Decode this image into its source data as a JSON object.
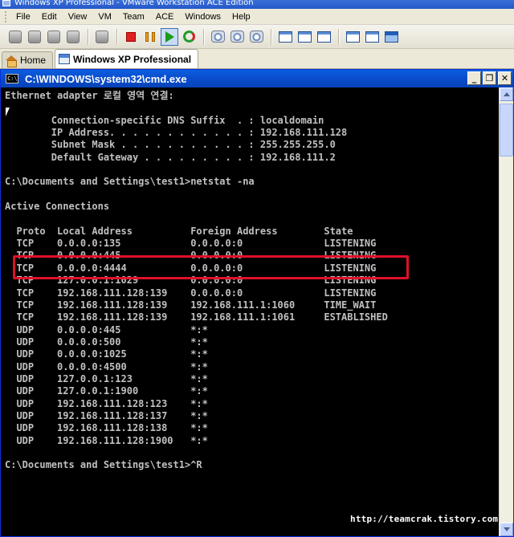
{
  "vmware": {
    "window_title": "Windows XP Professional - VMware Workstation ACE Edition",
    "menu": [
      "File",
      "Edit",
      "View",
      "VM",
      "Team",
      "ACE",
      "Windows",
      "Help"
    ],
    "tabs": [
      {
        "label": "Home",
        "icon": "home-icon"
      },
      {
        "label": "Windows XP Professional",
        "icon": "vm-icon",
        "active": true
      }
    ]
  },
  "cmd": {
    "title": "C:\\WINDOWS\\system32\\cmd.exe",
    "icon_text": "C:\\",
    "lines": [
      "Ethernet adapter 로컬 영역 연결:",
      "",
      "        Connection-specific DNS Suffix  . : localdomain",
      "        IP Address. . . . . . . . . . . . : 192.168.111.128",
      "        Subnet Mask . . . . . . . . . . . : 255.255.255.0",
      "        Default Gateway . . . . . . . . . : 192.168.111.2",
      "",
      "C:\\Documents and Settings\\test1>netstat -na",
      "",
      "Active Connections",
      "",
      "  Proto  Local Address          Foreign Address        State",
      "  TCP    0.0.0.0:135            0.0.0.0:0              LISTENING",
      "  TCP    0.0.0.0:445            0.0.0.0:0              LISTENING",
      "  TCP    0.0.0.0:4444           0.0.0.0:0              LISTENING",
      "  TCP    127.0.0.1:1029         0.0.0.0:0              LISTENING",
      "  TCP    192.168.111.128:139    0.0.0.0:0              LISTENING",
      "  TCP    192.168.111.128:139    192.168.111.1:1060     TIME_WAIT",
      "  TCP    192.168.111.128:139    192.168.111.1:1061     ESTABLISHED",
      "  UDP    0.0.0.0:445            *:*",
      "  UDP    0.0.0.0:500            *:*",
      "  UDP    0.0.0.0:1025           *:*",
      "  UDP    0.0.0.0:4500           *:*",
      "  UDP    127.0.0.1:123          *:*",
      "  UDP    127.0.0.1:1900         *:*",
      "  UDP    192.168.111.128:123    *:*",
      "  UDP    192.168.111.128:137    *:*",
      "  UDP    192.168.111.128:138    *:*",
      "  UDP    192.168.111.128:1900   *:*",
      "",
      "C:\\Documents and Settings\\test1>^R"
    ],
    "buttons": {
      "minimize": "_",
      "restore": "❐",
      "close": "✕"
    }
  },
  "colors": {
    "highlight": "#e0102a",
    "console_text": "#c0c0c0",
    "title_blue": "#0a5fe0"
  },
  "watermark": "http://teamcrak.tistory.com"
}
